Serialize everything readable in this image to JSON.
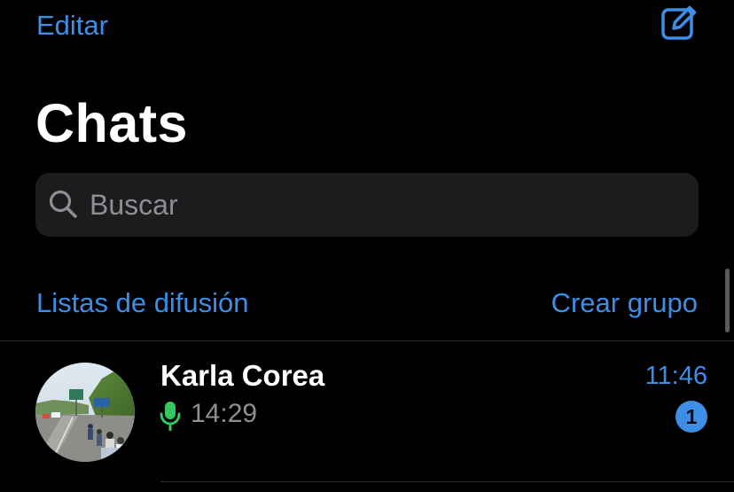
{
  "header": {
    "edit_label": "Editar",
    "compose_icon": "compose-icon",
    "title": "Chats"
  },
  "search": {
    "icon": "search-icon",
    "placeholder": "Buscar",
    "value": ""
  },
  "actions": {
    "broadcast_label": "Listas de difusión",
    "new_group_label": "Crear grupo"
  },
  "chats": [
    {
      "name": "Karla Corea",
      "last_message_icon": "microphone-icon",
      "last_message": "14:29",
      "time": "11:46",
      "unread_count": "1"
    }
  ],
  "colors": {
    "background": "#000000",
    "accent": "#3d8ee6",
    "search_background": "#1c1c1e",
    "secondary_text": "#8e8e93",
    "voice_note_green": "#34c759",
    "divider": "#2c2c2e"
  }
}
